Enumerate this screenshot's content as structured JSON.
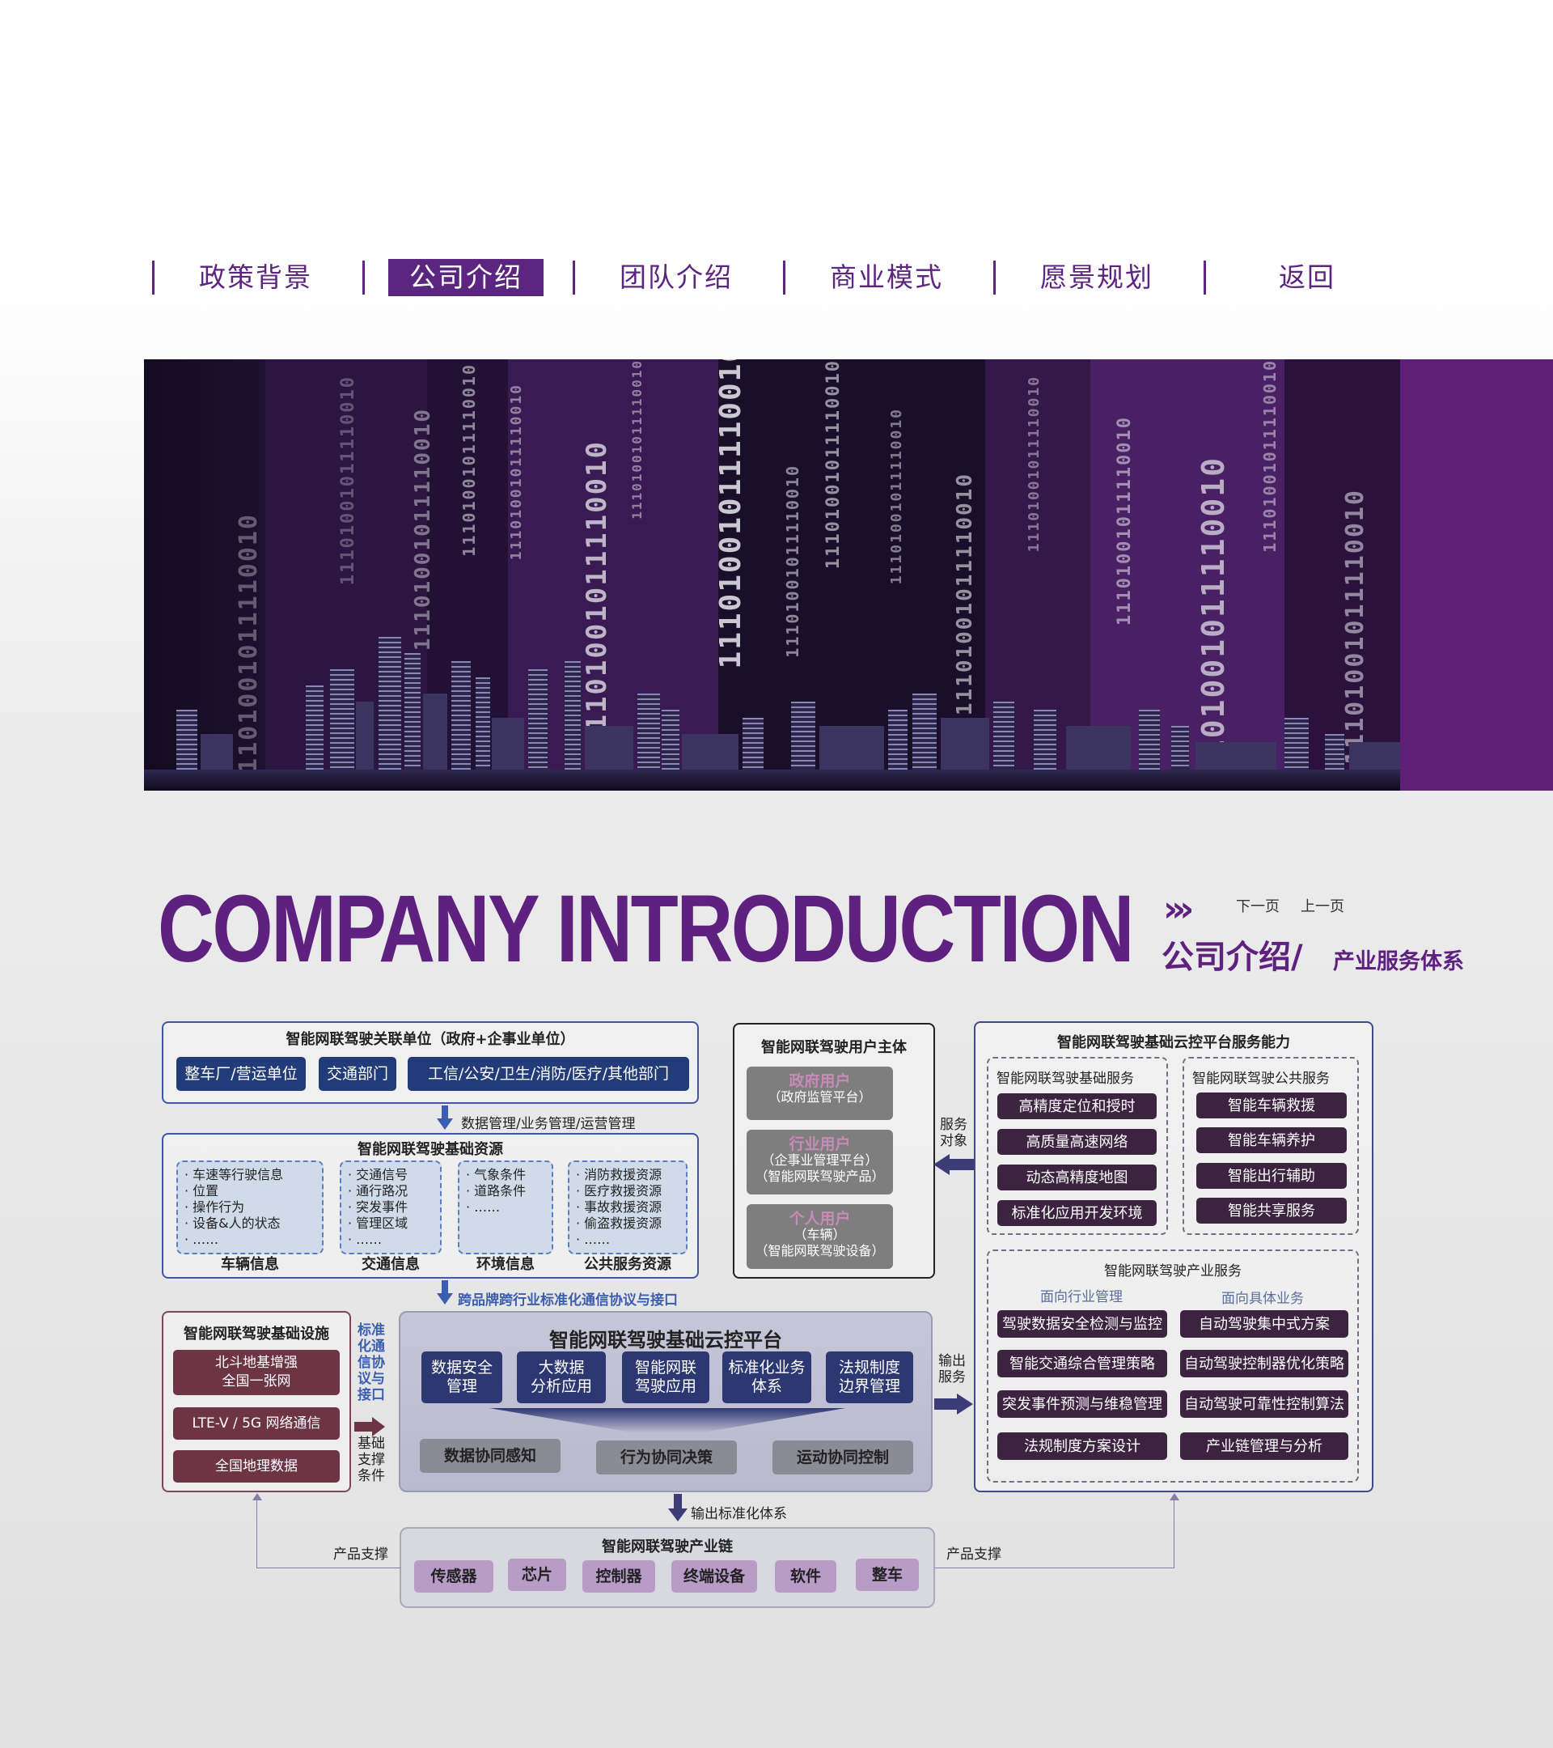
{
  "nav": {
    "items": [
      {
        "label": "政策背景"
      },
      {
        "label": "公司介绍",
        "active": true
      },
      {
        "label": "团队介绍"
      },
      {
        "label": "商业模式"
      },
      {
        "label": "愿景规划"
      },
      {
        "label": "返回"
      }
    ]
  },
  "header": {
    "title": "COMPANY INTRODUCTION",
    "next_label": "下一页",
    "prev_label": "上一页",
    "section": "公司介绍/",
    "subsection": "产业服务体系"
  },
  "banner": {
    "code_text": "11101001011110010"
  },
  "diagram": {
    "related": {
      "title": "智能网联驾驶关联单位（政府+企事业单位）",
      "buttons": [
        "整车厂/营运单位",
        "交通部门",
        "工信/公安/卫生/消防/医疗/其他部门"
      ]
    },
    "flow1": "数据管理/业务管理/运营管理",
    "resources": {
      "title": "智能网联驾驶基础资源",
      "groups": [
        {
          "items": [
            "· 车速等行驶信息",
            "· 位置",
            "· 操作行为",
            "· 设备&人的状态",
            "· ……"
          ],
          "caption": "车辆信息"
        },
        {
          "items": [
            "· 交通信号",
            "· 通行路况",
            "· 突发事件",
            "· 管理区域",
            "· ……"
          ],
          "caption": "交通信息"
        },
        {
          "items": [
            "· 气象条件",
            "· 道路条件",
            "· ……"
          ],
          "caption": "环境信息"
        },
        {
          "items": [
            "· 消防救援资源",
            "· 医疗救援资源",
            "· 事故救援资源",
            "· 偷盗救援资源",
            "· ……"
          ],
          "caption": "公共服务资源"
        }
      ]
    },
    "flow2": "跨品牌跨行业标准化通信协议与接口",
    "users": {
      "title": "智能网联驾驶用户主体",
      "items": [
        {
          "name": "政府用户",
          "desc": [
            "（政府监管平台）"
          ]
        },
        {
          "name": "行业用户",
          "desc": [
            "（企事业管理平台）",
            "（智能网联驾驶产品）"
          ]
        },
        {
          "name": "个人用户",
          "desc": [
            "（车辆）",
            "（智能网联驾驶设备）"
          ]
        }
      ]
    },
    "service_target": "服务\n对象",
    "cloud_service": {
      "title": "智能网联驾驶基础云控平台服务能力",
      "basic": {
        "title": "智能网联驾驶基础服务",
        "items": [
          "高精度定位和授时",
          "高质量高速网络",
          "动态高精度地图",
          "标准化应用开发环境"
        ]
      },
      "public": {
        "title": "智能网联驾驶公共服务",
        "items": [
          "智能车辆救援",
          "智能车辆养护",
          "智能出行辅助",
          "智能共享服务"
        ]
      },
      "industry": {
        "title": "智能网联驾驶产业服务",
        "left_title": "面向行业管理",
        "right_title": "面向具体业务",
        "left": [
          "驾驶数据安全检测与监控",
          "智能交通综合管理策略",
          "突发事件预测与维稳管理",
          "法规制度方案设计"
        ],
        "right": [
          "自动驾驶集中式方案",
          "自动驾驶控制器优化策略",
          "自动驾驶可靠性控制算法",
          "产业链管理与分析"
        ]
      }
    },
    "infra": {
      "title": "智能网联驾驶基础设施",
      "items": [
        "北斗地基增强\n全国一张网",
        "LTE-V / 5G 网络通信",
        "全国地理数据"
      ]
    },
    "side_label": "标准\n化通\n信协\n议与\n接口",
    "support_label": "基础\n支撑\n条件",
    "platform": {
      "title": "智能网联驾驶基础云控平台",
      "modules": [
        "数据安全\n管理",
        "大数据\n分析应用",
        "智能网联\n驾驶应用",
        "标准化业务\n体系",
        "法规制度\n边界管理"
      ],
      "bottom": [
        "数据协同感知",
        "行为协同决策",
        "运动协同控制"
      ]
    },
    "output_service": "输出\n服务",
    "output_std": "输出标准化体系",
    "chain": {
      "title": "智能网联驾驶产业链",
      "items": [
        "传感器",
        "芯片",
        "控制器",
        "终端设备",
        "软件",
        "整车"
      ]
    },
    "support_left": "产品支撑",
    "support_right": "产品支撑"
  },
  "colors": {
    "brand_purple": "#5e2180",
    "navy": "#223b79",
    "frame_blue": "#3e57a8"
  }
}
